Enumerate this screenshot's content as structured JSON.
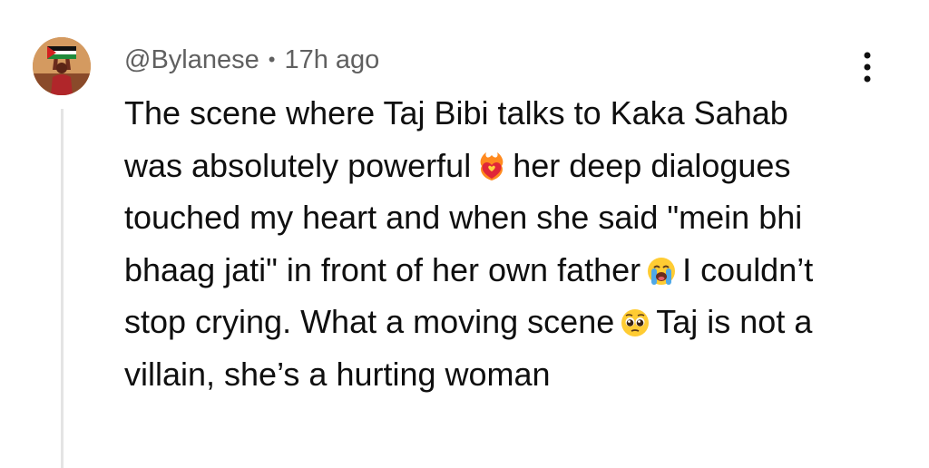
{
  "comment": {
    "author": "@Bylanese",
    "separator": "•",
    "time": "17h ago",
    "text": {
      "seg1": "The scene where Taj Bibi talks to Kaka Sahab was absolutely powerful",
      "seg2": "her deep dialogues touched my heart and when she said \"mein bhi bhaag jati\" in front of her own father",
      "seg3": "I couldn’t stop crying. What a moving scene",
      "seg4": "Taj is not a villain, she’s a hurting woman"
    },
    "emojis": [
      "heart-on-fire-icon",
      "loudly-crying-face-icon",
      "pleading-face-icon"
    ]
  }
}
